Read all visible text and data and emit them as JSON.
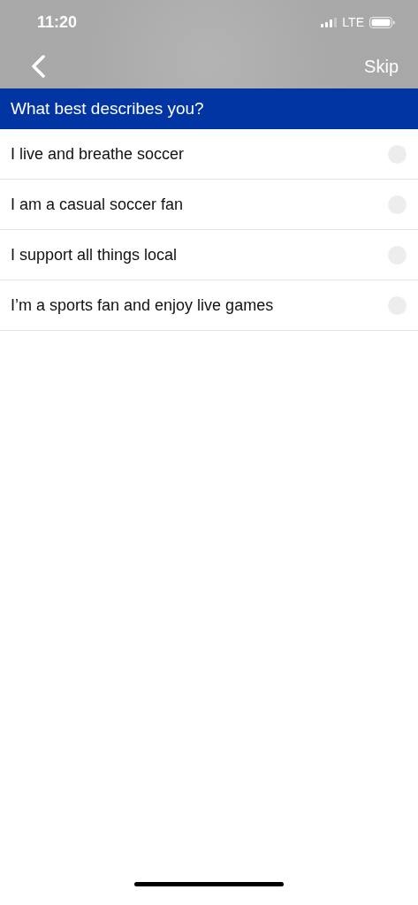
{
  "status_bar": {
    "time": "11:20",
    "network": "LTE"
  },
  "nav": {
    "skip": "Skip"
  },
  "question": "What best describes you?",
  "options": [
    {
      "label": "I live and breathe soccer",
      "selected": false
    },
    {
      "label": "I am a casual soccer fan",
      "selected": false
    },
    {
      "label": "I support all things local",
      "selected": false
    },
    {
      "label": "I’m a sports fan and enjoy live games",
      "selected": false
    }
  ]
}
